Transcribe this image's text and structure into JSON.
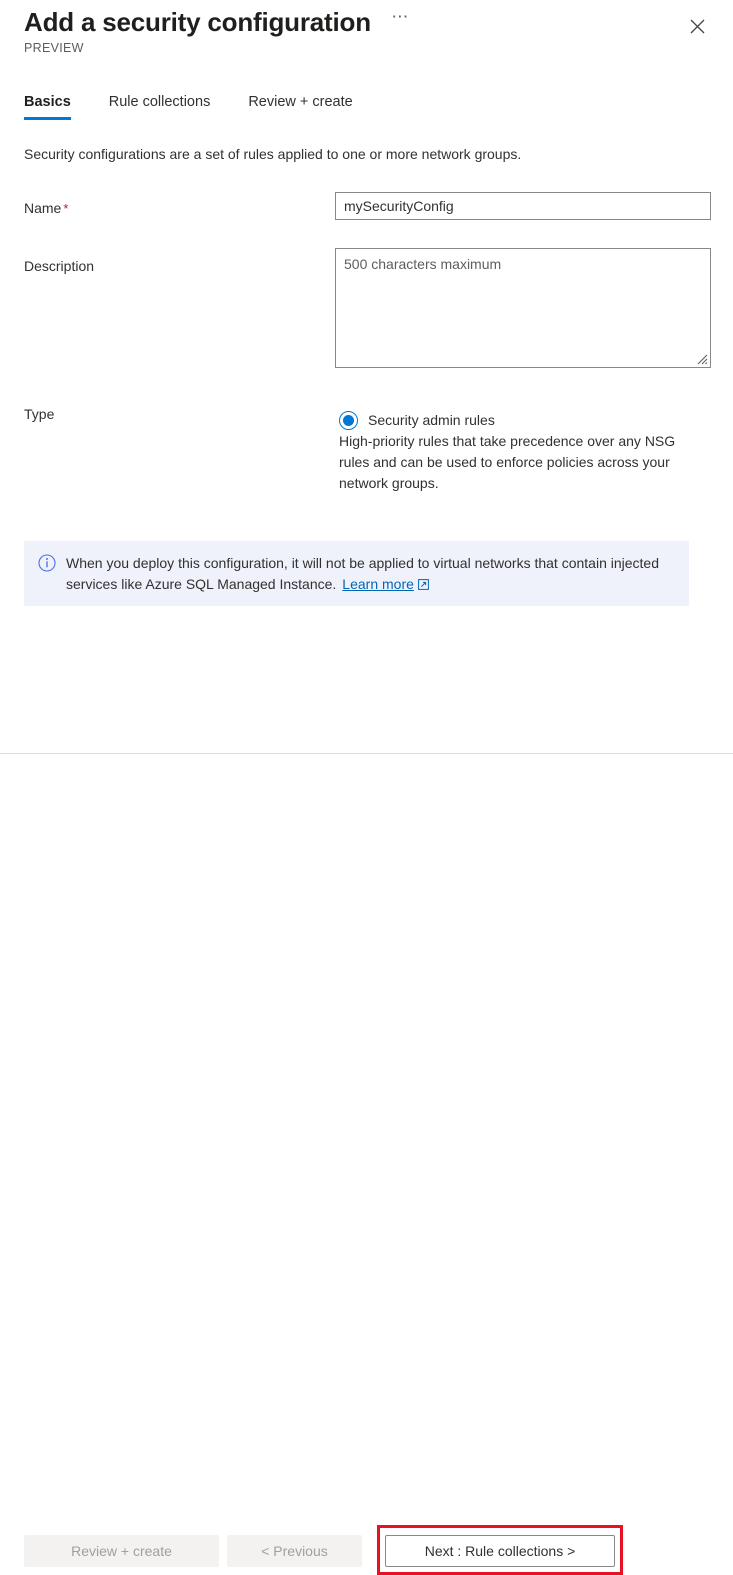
{
  "header": {
    "title": "Add a security configuration",
    "preview_label": "PREVIEW",
    "more_icon": "ellipsis-icon",
    "close_icon": "close-icon"
  },
  "tabs": [
    {
      "label": "Basics",
      "active": true
    },
    {
      "label": "Rule collections",
      "active": false
    },
    {
      "label": "Review + create",
      "active": false
    }
  ],
  "main": {
    "intro": "Security configurations are a set of rules applied to one or more network groups.",
    "fields": {
      "name": {
        "label": "Name",
        "required_marker": "*",
        "value": "mySecurityConfig",
        "placeholder": ""
      },
      "description": {
        "label": "Description",
        "value": "",
        "placeholder": "500 characters maximum"
      },
      "type": {
        "label": "Type",
        "options": [
          {
            "label": "Security admin rules",
            "description": "High-priority rules that take precedence over any NSG rules and can be used to enforce policies across your network groups.",
            "selected": true
          }
        ]
      }
    },
    "info_banner": {
      "icon": "info-circle-icon",
      "text": "When you deploy this configuration, it will not be applied to virtual networks that contain injected services like Azure SQL Managed Instance.",
      "link_label": "Learn more",
      "link_icon": "external-link-icon"
    }
  },
  "footer": {
    "review_create": "Review + create",
    "previous": "< Previous",
    "next": "Next : Rule collections >"
  },
  "colors": {
    "accent": "#0078d4",
    "link": "#0067b8",
    "required": "#a4262c",
    "banner_bg": "#eff2fb",
    "highlight": "#e81123",
    "disabled_bg": "#f3f2f1",
    "disabled_text": "#a19f9d"
  }
}
